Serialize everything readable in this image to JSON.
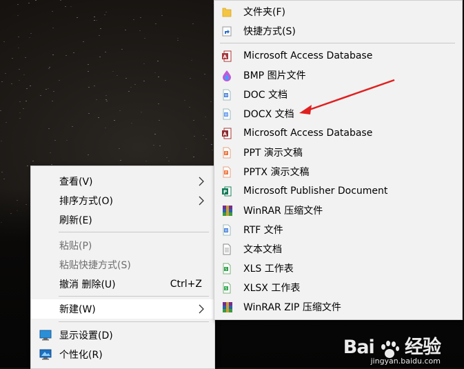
{
  "context_menu": {
    "items": [
      {
        "label": "查看(V)",
        "shortcut": "",
        "submenu": true,
        "disabled": false
      },
      {
        "label": "排序方式(O)",
        "shortcut": "",
        "submenu": true,
        "disabled": false
      },
      {
        "label": "刷新(E)",
        "shortcut": "",
        "submenu": false,
        "disabled": false
      },
      {
        "label": "粘贴(P)",
        "shortcut": "",
        "submenu": false,
        "disabled": true
      },
      {
        "label": "粘贴快捷方式(S)",
        "shortcut": "",
        "submenu": false,
        "disabled": true
      },
      {
        "label": "撤消 删除(U)",
        "shortcut": "Ctrl+Z",
        "submenu": false,
        "disabled": false
      },
      {
        "label": "新建(W)",
        "shortcut": "",
        "submenu": true,
        "disabled": false,
        "highlighted": true
      },
      {
        "label": "显示设置(D)",
        "shortcut": "",
        "submenu": false,
        "disabled": false
      },
      {
        "label": "个性化(R)",
        "shortcut": "",
        "submenu": false,
        "disabled": false
      }
    ]
  },
  "new_submenu": {
    "items": [
      {
        "label": "文件夹(F)",
        "icon": "folder-icon"
      },
      {
        "label": "快捷方式(S)",
        "icon": "shortcut-icon"
      },
      {
        "label": "Microsoft Access Database",
        "icon": "access-icon"
      },
      {
        "label": "BMP 图片文件",
        "icon": "paint-icon"
      },
      {
        "label": "DOC 文档",
        "icon": "word-doc-icon"
      },
      {
        "label": "DOCX 文档",
        "icon": "word-docx-icon"
      },
      {
        "label": "Microsoft Access Database",
        "icon": "access-icon"
      },
      {
        "label": "PPT 演示文稿",
        "icon": "ppt-icon"
      },
      {
        "label": "PPTX 演示文稿",
        "icon": "pptx-icon"
      },
      {
        "label": "Microsoft Publisher Document",
        "icon": "publisher-icon"
      },
      {
        "label": "WinRAR 压缩文件",
        "icon": "winrar-icon"
      },
      {
        "label": "RTF 文件",
        "icon": "rtf-icon"
      },
      {
        "label": "文本文档",
        "icon": "text-doc-icon"
      },
      {
        "label": "XLS 工作表",
        "icon": "xls-icon"
      },
      {
        "label": "XLSX 工作表",
        "icon": "xlsx-icon"
      },
      {
        "label": "WinRAR ZIP 压缩文件",
        "icon": "winrar-zip-icon"
      }
    ]
  },
  "watermark": {
    "brand_left": "Bai",
    "brand_right": "经验",
    "url": "jingyan.baidu.com"
  },
  "colors": {
    "menu_bg": "#f2f2f2",
    "arrow_annotation": "#e02020",
    "separator": "#c8c8c8"
  }
}
